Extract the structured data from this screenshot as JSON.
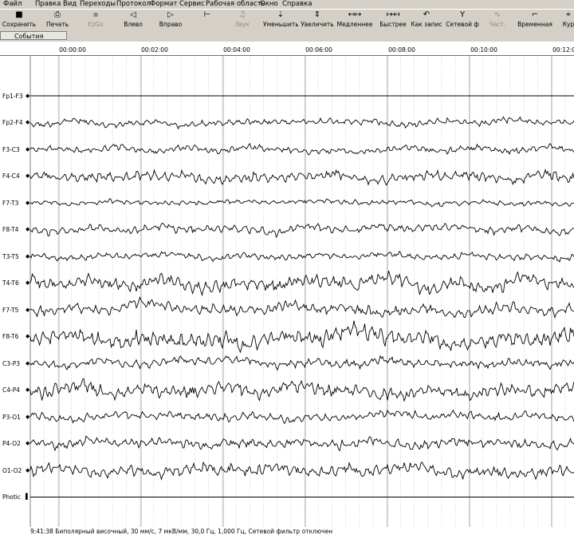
{
  "menu": [
    "Файл",
    "Правка",
    "Вид",
    "Переходы",
    "Протокол",
    "Формат",
    "Сервис",
    "Рабочая область",
    "Окно",
    "Справка"
  ],
  "toolbar": [
    {
      "label": "Сохранить",
      "icon": "save-icon",
      "glyph": "■",
      "enabled": true
    },
    {
      "label": "Печать",
      "icon": "print-icon",
      "glyph": "⎙",
      "enabled": true
    },
    {
      "label": "EzGo",
      "icon": "ezgo-icon",
      "glyph": "▪",
      "enabled": false
    },
    {
      "label": "Влево",
      "icon": "arrow-left-icon",
      "glyph": "◁",
      "enabled": true
    },
    {
      "label": "Вправо",
      "icon": "arrow-right-icon",
      "glyph": "▷",
      "enabled": true
    },
    {
      "label": "",
      "icon": "marker-tool-icon",
      "glyph": "⊢",
      "enabled": true
    },
    {
      "label": "Звук",
      "icon": "sound-icon",
      "glyph": "♫",
      "enabled": false
    },
    {
      "label": "Уменьшить",
      "icon": "decrease-icon",
      "glyph": "⇣",
      "enabled": true
    },
    {
      "label": "Увеличить",
      "icon": "increase-icon",
      "glyph": "⇕",
      "enabled": true
    },
    {
      "label": "Медленнее",
      "icon": "slower-icon",
      "glyph": "↤↦",
      "enabled": true
    },
    {
      "label": "Быстрее",
      "icon": "faster-icon",
      "glyph": "↦↤",
      "enabled": true
    },
    {
      "label": "Как запис",
      "icon": "as-recorded-icon",
      "glyph": "↶",
      "enabled": true
    },
    {
      "label": "Сетевой ф",
      "icon": "notch-filter-icon",
      "glyph": "Y",
      "enabled": true
    },
    {
      "label": "Част.",
      "icon": "frequency-icon",
      "glyph": "∿",
      "enabled": false
    },
    {
      "label": "Временная",
      "icon": "time-constant-icon",
      "glyph": "⌐",
      "enabled": true
    },
    {
      "label": "Кур",
      "icon": "cursor-icon",
      "glyph": "⌖",
      "enabled": true
    }
  ],
  "events_label": "События",
  "time_ticks": [
    "00:00:00",
    "00:02:00",
    "00:04:00",
    "00:06:00",
    "00:08:00",
    "00:10:00",
    "00:12:00"
  ],
  "channels": [
    "Fp1-F3",
    "Fp2-F4",
    "F3-C3",
    "F4-C4",
    "F7-T3",
    "F8-T4",
    "T3-T5",
    "T4-T6",
    "F7-T5",
    "F8-T6",
    "C3-P3",
    "C4-P4",
    "P3-O1",
    "P4-O2",
    "O1-O2",
    "Photic"
  ],
  "status_text": "9:41:38 Биполярный височный, 30 мм/с, 7 мкВ/мм, 30,0 Гц, 1,000 Гц, Сетевой фильтр отключен",
  "colors": {
    "toolbar_bg": "#d4d0c8",
    "progress": "#33cc33",
    "progress_dark": "#228822",
    "events_yellow": "#f4e400",
    "marker_blue": "#1a1aa0"
  }
}
